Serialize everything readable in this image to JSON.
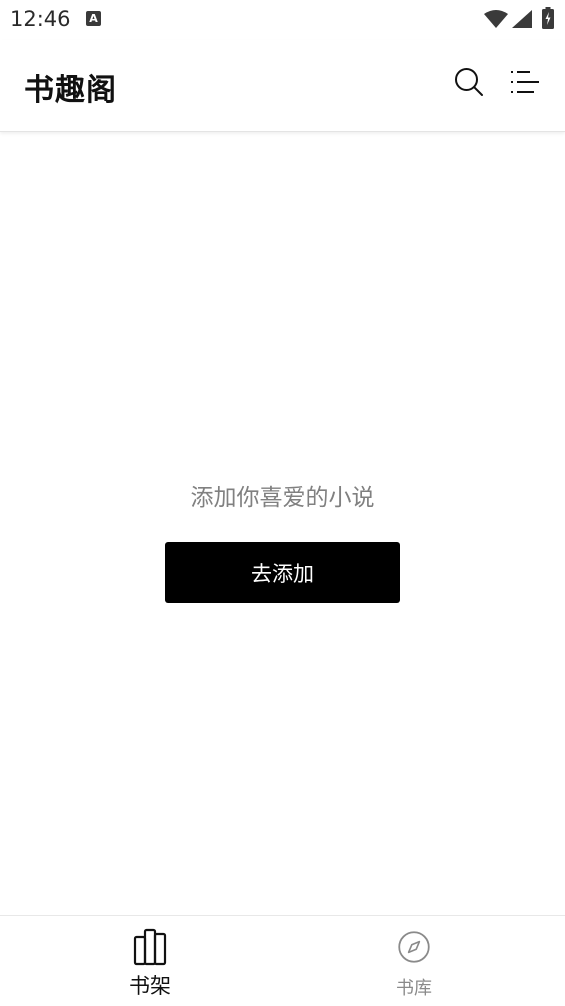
{
  "status_bar": {
    "time": "12:46",
    "notification_icon_letter": "A",
    "wifi_icon": "wifi-icon",
    "signal_icon": "signal-icon",
    "battery_icon": "battery-charging-icon"
  },
  "app_bar": {
    "title": "书趣阁",
    "search_icon": "search-icon",
    "menu_icon": "menu-list-icon"
  },
  "empty_state": {
    "message": "添加你喜爱的小说",
    "button_label": "去添加"
  },
  "bottom_nav": {
    "tabs": [
      {
        "label": "书架",
        "icon": "bookshelf-icon",
        "active": true
      },
      {
        "label": "书库",
        "icon": "compass-icon",
        "active": false
      }
    ]
  },
  "colors": {
    "background": "#ffffff",
    "primary_text": "#111111",
    "secondary_text": "#808080",
    "inactive_tab": "#8a8a8a",
    "button_bg": "#000000",
    "button_text": "#ffffff"
  }
}
